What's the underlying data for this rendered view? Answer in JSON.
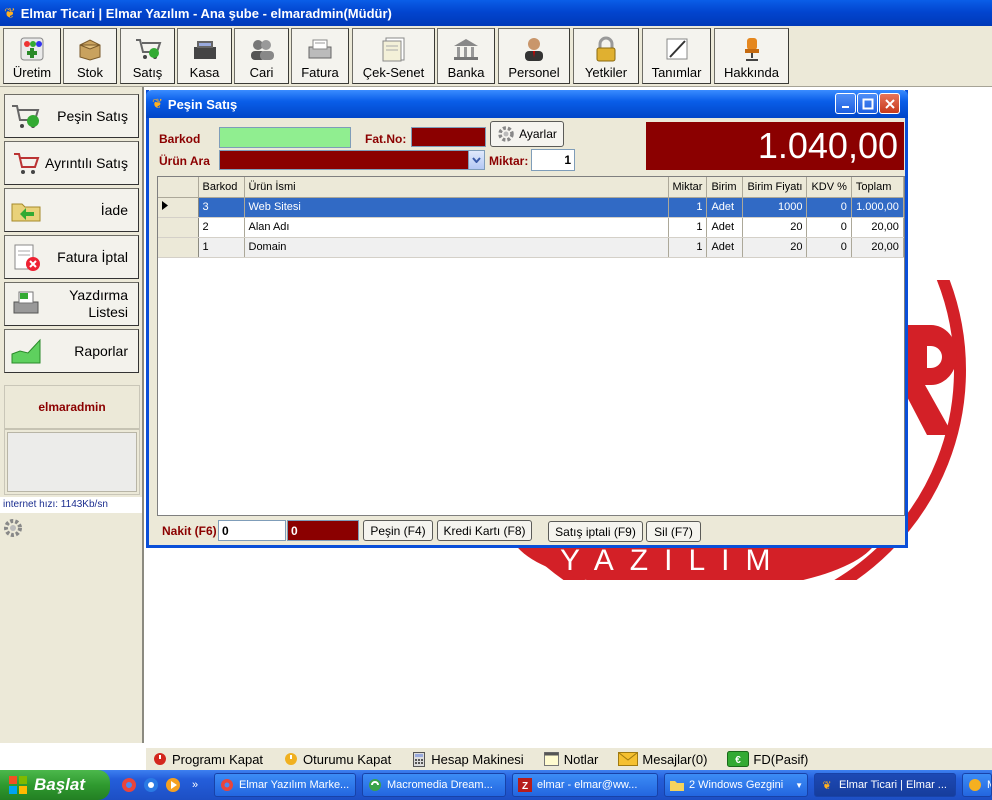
{
  "app": {
    "title": "Elmar Ticari | Elmar Yazılım - Ana şube - elmaradmin(Müdür)"
  },
  "toolbar": [
    {
      "id": "uretim",
      "label": "Üretim"
    },
    {
      "id": "stok",
      "label": "Stok"
    },
    {
      "id": "satis",
      "label": "Satış"
    },
    {
      "id": "kasa",
      "label": "Kasa"
    },
    {
      "id": "cari",
      "label": "Cari"
    },
    {
      "id": "fatura",
      "label": "Fatura"
    },
    {
      "id": "cek-senet",
      "label": "Çek-Senet"
    },
    {
      "id": "banka",
      "label": "Banka"
    },
    {
      "id": "personel",
      "label": "Personel"
    },
    {
      "id": "yetkiler",
      "label": "Yetkiler"
    },
    {
      "id": "tanimlar",
      "label": "Tanımlar"
    },
    {
      "id": "hakkinda",
      "label": "Hakkında"
    }
  ],
  "sidebar": {
    "items": [
      {
        "label": "Peşin Satış"
      },
      {
        "label": "Ayrıntılı Satış"
      },
      {
        "label": "İade"
      },
      {
        "label": "Fatura İptal"
      },
      {
        "label": "Yazdırma Listesi"
      },
      {
        "label": "Raporlar"
      }
    ],
    "user": "elmaradmin",
    "net_speed": "internet hızı: 1143Kb/sn"
  },
  "window": {
    "title": "Peşin Satış",
    "barkod_label": "Barkod",
    "fatno_label": "Fat.No:",
    "urun_ara_label": "Ürün Ara",
    "miktar_label": "Miktar:",
    "miktar_value": "1",
    "ayarlar_label": "Ayarlar",
    "total": "1.040,00",
    "grid": {
      "columns": [
        "Barkod",
        "Ürün İsmi",
        "Miktar",
        "Birim",
        "Birim Fiyatı",
        "KDV %",
        "Toplam"
      ],
      "rows": [
        [
          "3",
          "Web Sitesi",
          "1",
          "Adet",
          "1000",
          "0",
          "1.000,00"
        ],
        [
          "2",
          "Alan Adı",
          "1",
          "Adet",
          "20",
          "0",
          "20,00"
        ],
        [
          "1",
          "Domain",
          "1",
          "Adet",
          "20",
          "0",
          "20,00"
        ]
      ]
    },
    "nakit_label": "Nakit (F6)",
    "nakit_value": "0",
    "para_ustu_value": "0",
    "pesin_label": "Peşin (F4)",
    "kredi_label": "Kredi Kartı (F8)",
    "satis_iptal_label": "Satış iptali (F9)",
    "sil_label": "Sil (F7)"
  },
  "commands": [
    {
      "label": "Programı Kapat"
    },
    {
      "label": "Oturumu Kapat"
    },
    {
      "label": "Hesap Makinesi"
    },
    {
      "label": "Notlar"
    },
    {
      "label": "Mesajlar(0)"
    },
    {
      "label": "FD(Pasif)"
    }
  ],
  "taskbar": {
    "start_label": "Başlat",
    "items": [
      {
        "label": "Elmar Yazılım Marke..."
      },
      {
        "label": "Macromedia Dream..."
      },
      {
        "label": "elmar - elmar@ww..."
      },
      {
        "label": "2 Windows Gezgini"
      },
      {
        "label": "Elmar Ticari | Elmar ..."
      },
      {
        "label": "M"
      }
    ]
  }
}
